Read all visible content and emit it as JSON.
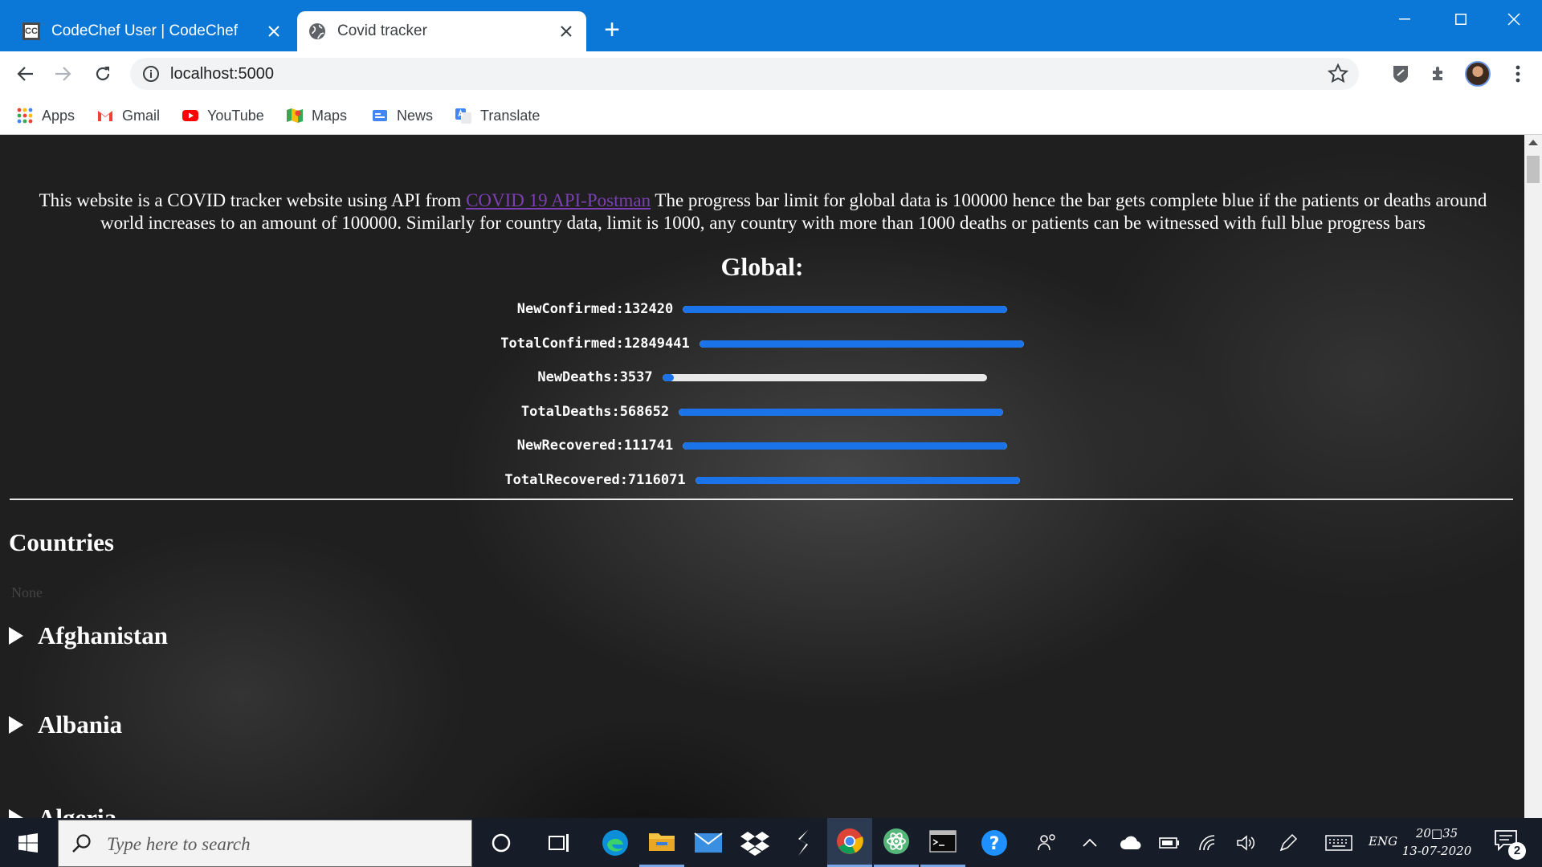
{
  "browser": {
    "tabs": [
      {
        "title": "CodeChef User | CodeChef",
        "favicon": "codechef-icon",
        "favicon_text": "CC",
        "active": false
      },
      {
        "title": "Covid tracker",
        "favicon": "globe-icon",
        "active": true
      }
    ],
    "url": "localhost:5000",
    "bookmarks": [
      {
        "label": "Apps",
        "icon": "apps-grid-icon"
      },
      {
        "label": "Gmail",
        "icon": "gmail-icon"
      },
      {
        "label": "YouTube",
        "icon": "youtube-icon"
      },
      {
        "label": "Maps",
        "icon": "maps-icon"
      },
      {
        "label": "News",
        "icon": "news-icon"
      },
      {
        "label": "Translate",
        "icon": "translate-icon"
      }
    ]
  },
  "page": {
    "intro_before_link": "This website is a COVID tracker website using API from ",
    "intro_link": "COVID 19 API-Postman",
    "intro_after_link": " The progress bar limit for global data is 100000 hence the bar gets complete blue if the patients or deaths around world increases to an amount of 100000. Similarly for country data, limit is 1000, any country with more than 1000 deaths or patients can be witnessed with full blue progress bars",
    "global_title": "Global:",
    "global_limit": 100000,
    "global_stats": [
      {
        "label": "NewConfirmed:132420",
        "value": 132420
      },
      {
        "label": "TotalConfirmed:12849441",
        "value": 12849441
      },
      {
        "label": "NewDeaths:3537",
        "value": 3537
      },
      {
        "label": "TotalDeaths:568652",
        "value": 568652
      },
      {
        "label": "NewRecovered:111741",
        "value": 111741
      },
      {
        "label": "TotalRecovered:7116071",
        "value": 7116071
      }
    ],
    "countries_title": "Countries",
    "countries_note": "None",
    "countries": [
      "Afghanistan",
      "Albania",
      "Algeria"
    ]
  },
  "taskbar": {
    "search_placeholder": "Type here to search",
    "apps": [
      "cortana-icon",
      "task-view-icon",
      "edge-icon",
      "file-explorer-icon",
      "mail-icon",
      "dropbox-icon",
      "sublime-text-icon",
      "chrome-icon",
      "atom-icon",
      "terminal-icon",
      "help-icon"
    ],
    "language": "ENG",
    "time": "20□35",
    "date": "13-07-2020",
    "notification_count": "2"
  },
  "colors": {
    "accent": "#1a73e8",
    "titlebar": "#0b78d7",
    "taskbar": "#161d28"
  }
}
